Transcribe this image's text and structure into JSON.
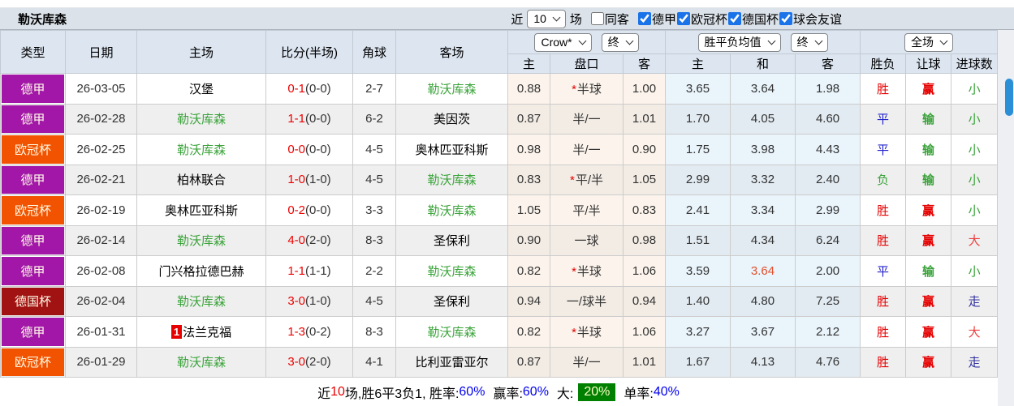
{
  "colors": {
    "league": {
      "德甲": "#a217a8",
      "欧冠杯": "#f25300",
      "德国杯": "#a11212"
    },
    "scrollbar_blue": "#2b8fd8",
    "score_red": "#ee0000",
    "team_green": "#3aa33a",
    "result_red": "#e60000",
    "result_blue": "#2222cc",
    "walk_navy": "#3333a0",
    "hot_orange": "#e2502c",
    "big_rate_bg": "#008000",
    "rate_blue": "#0000ee",
    "checkbox_blue": "#1a73e8"
  },
  "title_bar": {
    "team": "勒沃库森",
    "near_label": "近",
    "matches_value": "10",
    "matches_label": "场",
    "same_venue_label": "同客",
    "same_venue_checked": false,
    "league_filters": [
      {
        "label": "德甲",
        "checked": true
      },
      {
        "label": "欧冠杯",
        "checked": true
      },
      {
        "label": "德国杯",
        "checked": true
      },
      {
        "label": "球会友谊",
        "checked": true
      }
    ]
  },
  "table": {
    "headers": {
      "type": "类型",
      "date": "日期",
      "home": "主场",
      "score": "比分(半场)",
      "corner": "角球",
      "away": "客场",
      "crow_select": "Crow*",
      "crow_time_select": "终",
      "avg_select": "胜平负均值",
      "avg_time_select": "终",
      "scope_select": "全场",
      "sub": {
        "crow_home": "主",
        "handicap": "盘口",
        "crow_away": "客",
        "avg_home": "主",
        "avg_draw": "和",
        "avg_away": "客",
        "result": "胜负",
        "handicap_result": "让球",
        "goals": "进球数"
      }
    },
    "rows": [
      {
        "league": "德甲",
        "date": "26-03-05",
        "home": "汉堡",
        "home_rank": "",
        "score_ft": "0-1",
        "score_ht": "(0-0)",
        "corner": "2-7",
        "away": "勒沃库森",
        "crow_home": "0.88",
        "handicap_star": true,
        "handicap": "半球",
        "crow_away": "1.00",
        "avg_home": "3.65",
        "avg_draw": "3.64",
        "avg_draw_hot": false,
        "avg_away": "1.98",
        "result": "胜",
        "handicap_result": "赢",
        "goals": "小"
      },
      {
        "league": "德甲",
        "date": "26-02-28",
        "home": "勒沃库森",
        "home_rank": "",
        "score_ft": "1-1",
        "score_ht": "(0-0)",
        "corner": "6-2",
        "away": "美因茨",
        "crow_home": "0.87",
        "handicap_star": false,
        "handicap": "半/一",
        "crow_away": "1.01",
        "avg_home": "1.70",
        "avg_draw": "4.05",
        "avg_draw_hot": false,
        "avg_away": "4.60",
        "result": "平",
        "handicap_result": "输",
        "goals": "小"
      },
      {
        "league": "欧冠杯",
        "date": "26-02-25",
        "home": "勒沃库森",
        "home_rank": "",
        "score_ft": "0-0",
        "score_ht": "(0-0)",
        "corner": "4-5",
        "away": "奥林匹亚科斯",
        "crow_home": "0.98",
        "handicap_star": false,
        "handicap": "半/一",
        "crow_away": "0.90",
        "avg_home": "1.75",
        "avg_draw": "3.98",
        "avg_draw_hot": false,
        "avg_away": "4.43",
        "result": "平",
        "handicap_result": "输",
        "goals": "小"
      },
      {
        "league": "德甲",
        "date": "26-02-21",
        "home": "柏林联合",
        "home_rank": "",
        "score_ft": "1-0",
        "score_ht": "(1-0)",
        "corner": "4-5",
        "away": "勒沃库森",
        "crow_home": "0.83",
        "handicap_star": true,
        "handicap": "平/半",
        "crow_away": "1.05",
        "avg_home": "2.99",
        "avg_draw": "3.32",
        "avg_draw_hot": false,
        "avg_away": "2.40",
        "result": "负",
        "handicap_result": "输",
        "goals": "小"
      },
      {
        "league": "欧冠杯",
        "date": "26-02-19",
        "home": "奥林匹亚科斯",
        "home_rank": "",
        "score_ft": "0-2",
        "score_ht": "(0-0)",
        "corner": "3-3",
        "away": "勒沃库森",
        "crow_home": "1.05",
        "handicap_star": false,
        "handicap": "平/半",
        "crow_away": "0.83",
        "avg_home": "2.41",
        "avg_draw": "3.34",
        "avg_draw_hot": false,
        "avg_away": "2.99",
        "result": "胜",
        "handicap_result": "赢",
        "goals": "小"
      },
      {
        "league": "德甲",
        "date": "26-02-14",
        "home": "勒沃库森",
        "home_rank": "",
        "score_ft": "4-0",
        "score_ht": "(2-0)",
        "corner": "8-3",
        "away": "圣保利",
        "crow_home": "0.90",
        "handicap_star": false,
        "handicap": "一球",
        "crow_away": "0.98",
        "avg_home": "1.51",
        "avg_draw": "4.34",
        "avg_draw_hot": false,
        "avg_away": "6.24",
        "result": "胜",
        "handicap_result": "赢",
        "goals": "大"
      },
      {
        "league": "德甲",
        "date": "26-02-08",
        "home": "门兴格拉德巴赫",
        "home_rank": "",
        "score_ft": "1-1",
        "score_ht": "(1-1)",
        "corner": "2-2",
        "away": "勒沃库森",
        "crow_home": "0.82",
        "handicap_star": true,
        "handicap": "半球",
        "crow_away": "1.06",
        "avg_home": "3.59",
        "avg_draw": "3.64",
        "avg_draw_hot": true,
        "avg_away": "2.00",
        "result": "平",
        "handicap_result": "输",
        "goals": "小"
      },
      {
        "league": "德国杯",
        "date": "26-02-04",
        "home": "勒沃库森",
        "home_rank": "",
        "score_ft": "3-0",
        "score_ht": "(1-0)",
        "corner": "4-5",
        "away": "圣保利",
        "crow_home": "0.94",
        "handicap_star": false,
        "handicap": "一/球半",
        "crow_away": "0.94",
        "avg_home": "1.40",
        "avg_draw": "4.80",
        "avg_draw_hot": false,
        "avg_away": "7.25",
        "result": "胜",
        "handicap_result": "赢",
        "goals": "走"
      },
      {
        "league": "德甲",
        "date": "26-01-31",
        "home": "法兰克福",
        "home_rank": "1",
        "score_ft": "1-3",
        "score_ht": "(0-2)",
        "corner": "8-3",
        "away": "勒沃库森",
        "crow_home": "0.82",
        "handicap_star": true,
        "handicap": "半球",
        "crow_away": "1.06",
        "avg_home": "3.27",
        "avg_draw": "3.67",
        "avg_draw_hot": false,
        "avg_away": "2.12",
        "result": "胜",
        "handicap_result": "赢",
        "goals": "大"
      },
      {
        "league": "欧冠杯",
        "date": "26-01-29",
        "home": "勒沃库森",
        "home_rank": "",
        "score_ft": "3-0",
        "score_ht": "(2-0)",
        "corner": "4-1",
        "away": "比利亚雷亚尔",
        "crow_home": "0.87",
        "handicap_star": false,
        "handicap": "半/一",
        "crow_away": "1.01",
        "avg_home": "1.67",
        "avg_draw": "4.13",
        "avg_draw_hot": false,
        "avg_away": "4.76",
        "result": "胜",
        "handicap_result": "赢",
        "goals": "走"
      }
    ]
  },
  "footer": {
    "near": "近",
    "count": "10",
    "seg1": "场,胜6平3负1, 胜率:",
    "win_rate": "60%",
    "seg2": "赢率:",
    "profit_rate": "60%",
    "seg3": "大:",
    "big_rate": "20%",
    "seg4": "单率:",
    "single_rate": "40%"
  }
}
